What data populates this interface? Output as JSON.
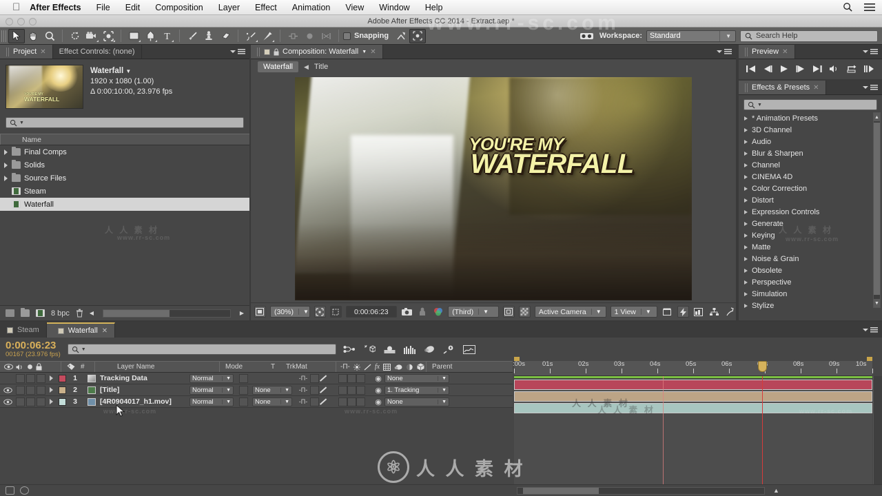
{
  "os_menu": {
    "apple_icon": "apple-icon",
    "items": [
      "After Effects",
      "File",
      "Edit",
      "Composition",
      "Layer",
      "Effect",
      "Animation",
      "View",
      "Window",
      "Help"
    ],
    "right_icons": [
      "search-icon",
      "list-icon"
    ]
  },
  "window": {
    "title": "Adobe After Effects CC 2014 - Extract.aep *"
  },
  "toolbar": {
    "tools": [
      "selection-tool",
      "hand-tool",
      "zoom-tool",
      "rotation-tool",
      "camera-tool",
      "pan-behind-tool",
      "shape-tool",
      "pen-tool",
      "type-tool",
      "brush-tool",
      "clone-stamp-tool",
      "eraser-tool",
      "roto-brush-tool",
      "puppet-pin-tool"
    ],
    "snapping_label": "Snapping",
    "workspace_label": "Workspace:",
    "workspace_value": "Standard",
    "search_help_placeholder": "Search Help"
  },
  "project_panel": {
    "tabs": [
      {
        "label": "Project",
        "active": true,
        "closable": true
      },
      {
        "label": "Effect Controls: (none)",
        "active": false,
        "closable": false
      }
    ],
    "selected_item": {
      "name": "Waterfall",
      "resolution": "1920 x 1080 (1.00)",
      "duration": "Δ 0:00:10:00, 23.976 fps"
    },
    "thumbnail_title_line1": "YOU'RE MY",
    "thumbnail_title_line2": "WATERFALL",
    "search_placeholder": "",
    "column_header": "Name",
    "items": [
      {
        "label": "Final Comps",
        "type": "folder",
        "expandable": true,
        "selected": false
      },
      {
        "label": "Solids",
        "type": "folder",
        "expandable": true,
        "selected": false
      },
      {
        "label": "Source Files",
        "type": "folder",
        "expandable": true,
        "selected": false
      },
      {
        "label": "Steam",
        "type": "comp",
        "expandable": false,
        "selected": false
      },
      {
        "label": "Waterfall",
        "type": "comp",
        "expandable": false,
        "selected": true
      }
    ],
    "footer": {
      "bit_depth": "8 bpc",
      "icons": [
        "new-comp-icon",
        "new-folder-icon",
        "new-footage-icon",
        "delete-icon"
      ]
    }
  },
  "composition_panel": {
    "tab_label": "Composition: Waterfall",
    "breadcrumb_active": "Waterfall",
    "breadcrumb_next": "Title",
    "canvas_title_line1": "YOU'RE MY",
    "canvas_title_line2": "WATERFALL",
    "footer": {
      "magnification": "(30%)",
      "timecode": "0:00:06:23",
      "resolution": "(Third)",
      "camera": "Active Camera",
      "views": "1 View",
      "icons": [
        "always-preview-icon",
        "region-of-interest-icon",
        "mask-icon",
        "snapshot-icon",
        "show-snapshot-icon",
        "channel-icon",
        "transparency-grid-icon",
        "title-safe-icon",
        "fast-previews-icon",
        "timeline-icon",
        "comp-flowchart-icon",
        "reset-exposure-icon"
      ]
    }
  },
  "preview_panel": {
    "tab_label": "Preview",
    "buttons": [
      "first-frame-icon",
      "previous-frame-icon",
      "play-icon",
      "next-frame-icon",
      "last-frame-icon",
      "audio-icon",
      "loop-icon",
      "ram-preview-icon"
    ]
  },
  "effects_panel": {
    "tab_label": "Effects & Presets",
    "search_placeholder": "",
    "categories": [
      "* Animation Presets",
      "3D Channel",
      "Audio",
      "Blur & Sharpen",
      "Channel",
      "CINEMA 4D",
      "Color Correction",
      "Distort",
      "Expression Controls",
      "Generate",
      "Keying",
      "Matte",
      "Noise & Grain",
      "Obsolete",
      "Perspective",
      "Simulation",
      "Stylize"
    ]
  },
  "timeline": {
    "tabs": [
      {
        "label": "Steam",
        "active": false,
        "closable": false
      },
      {
        "label": "Waterfall",
        "active": true,
        "closable": true
      }
    ],
    "current_time": "0:00:06:23",
    "current_frame": "00167 (23.976 fps)",
    "search_placeholder": "",
    "toolbar_icons": [
      "composition-mini-flowchart-icon",
      "draft-3d-icon",
      "hide-shy-layers-icon",
      "frame-blending-icon",
      "motion-blur-icon",
      "graph-editor-icon",
      "brainstorm-icon"
    ],
    "columns": [
      "#",
      "Layer Name",
      "Mode",
      "T",
      "TrkMat",
      "Parent"
    ],
    "layers": [
      {
        "index": "1",
        "name": "Tracking Data",
        "mode": "Normal",
        "trkmat": "",
        "parent": "None",
        "visible": false,
        "color": "#c44b5e",
        "bar_color": "#b8465a"
      },
      {
        "index": "2",
        "name": "[Title]",
        "mode": "Normal",
        "trkmat": "None",
        "parent": "1. Tracking",
        "visible": true,
        "color": "#c9b08a",
        "bar_color": "#bca486"
      },
      {
        "index": "3",
        "name": "[4R0904017_h1.mov]",
        "mode": "Normal",
        "trkmat": "None",
        "parent": "None",
        "visible": true,
        "color": "#c3ddd9",
        "bar_color": "#a8c6c0"
      }
    ],
    "ruler_labels": [
      ":00s",
      "01s",
      "02s",
      "03s",
      "04s",
      "05s",
      "06s",
      "07s",
      "08s",
      "09s",
      "10s"
    ],
    "playhead_time_fraction": 0.692
  },
  "watermark": {
    "text": "人 人 素 材",
    "url": "www.rr-sc.com",
    "brand": "人 人 素 材"
  },
  "colors": {
    "accent_gold": "#d9b05a",
    "playhead_red": "#d63b3b",
    "work_area_green": "#7bc043",
    "panel_bg": "#464646"
  }
}
